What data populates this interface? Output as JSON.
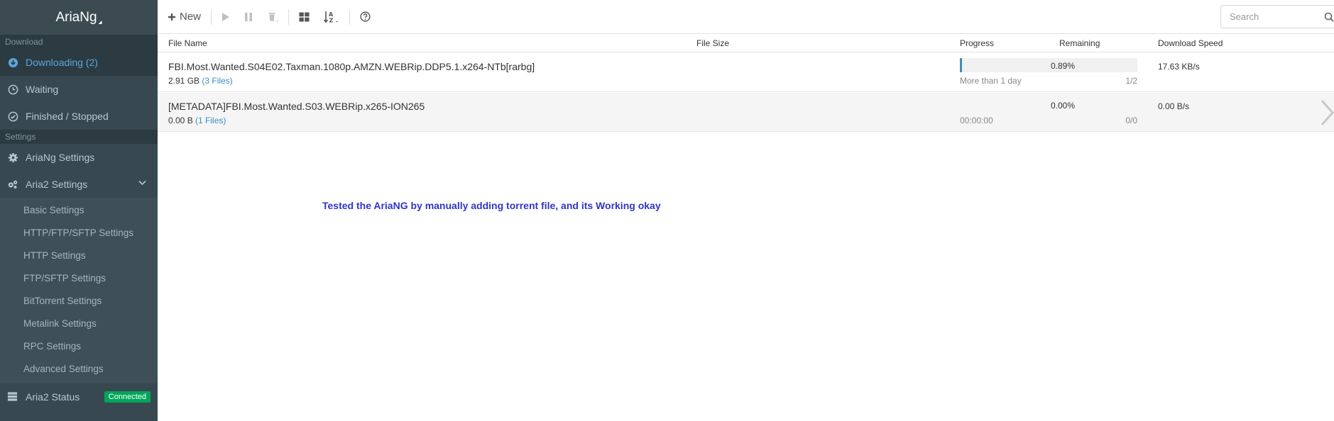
{
  "app": {
    "logo": "AriaNg"
  },
  "sidebar": {
    "download_header": "Download",
    "downloading": "Downloading (2)",
    "waiting": "Waiting",
    "finished": "Finished / Stopped",
    "settings_header": "Settings",
    "ariang_settings": "AriaNg Settings",
    "aria2_settings": "Aria2 Settings",
    "sub": [
      "Basic Settings",
      "HTTP/FTP/SFTP Settings",
      "HTTP Settings",
      "FTP/SFTP Settings",
      "BitTorrent Settings",
      "Metalink Settings",
      "RPC Settings",
      "Advanced Settings"
    ],
    "status": "Aria2 Status",
    "status_badge": "Connected"
  },
  "toolbar": {
    "new_label": "New",
    "search_placeholder": "Search"
  },
  "table": {
    "headers": {
      "file_name": "File Name",
      "file_size": "File Size",
      "progress": "Progress",
      "remaining": "Remaining",
      "speed": "Download Speed"
    },
    "rows": [
      {
        "name": "FBI.Most.Wanted.S04E02.Taxman.1080p.AMZN.WEBRip.DDP5.1.x264-NTb[rarbg]",
        "size": "2.91 GB",
        "files": "(3 Files)",
        "progress_text": "0.89%",
        "progress_fraction": 0.0089,
        "remaining": "More than 1 day",
        "connections": "1/2",
        "speed": "17.63 KB/s"
      },
      {
        "name": "[METADATA]FBI.Most.Wanted.S03.WEBRip.x265-ION265",
        "size": "0.00 B",
        "files": "(1 Files)",
        "progress_text": "0.00%",
        "progress_fraction": 0,
        "remaining": "00:00:00",
        "connections": "0/0",
        "speed": "0.00 B/s"
      }
    ]
  },
  "note": "Tested the AriaNG by manually adding torrent file, and its Working okay",
  "colors": {
    "accent": "#3c8dbc",
    "sidebar_bg": "#374850",
    "badge": "#00a65a",
    "note": "#2f36c8"
  }
}
